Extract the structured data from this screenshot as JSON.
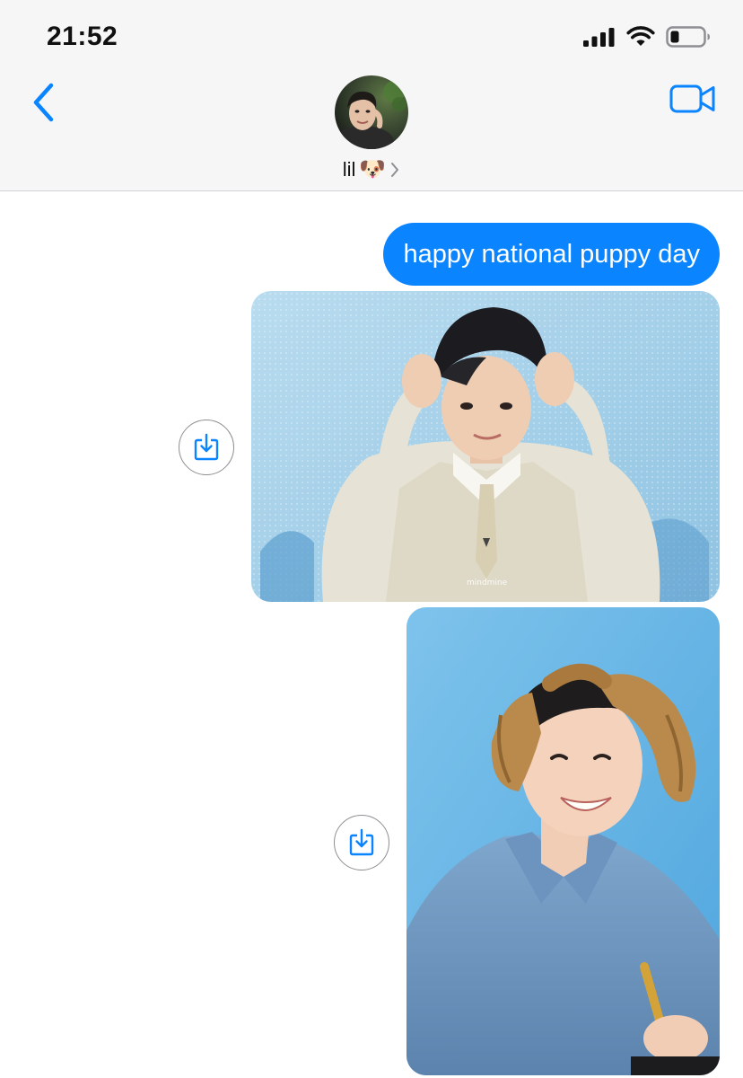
{
  "status_bar": {
    "time": "21:52"
  },
  "nav": {
    "back_icon": "chevron-left-icon",
    "video_icon": "video-camera-icon",
    "contact": {
      "name": "lil",
      "emoji": "🐶",
      "chevron_icon": "chevron-right-icon"
    }
  },
  "messages": [
    {
      "type": "text",
      "direction": "outgoing",
      "text": "happy national puppy day"
    },
    {
      "type": "image",
      "direction": "outgoing",
      "alt": "photo",
      "watermark": "mindmine"
    },
    {
      "type": "image",
      "direction": "outgoing",
      "alt": "photo"
    }
  ],
  "colors": {
    "accent": "#0a84ff",
    "header_bg": "#f6f6f7"
  }
}
